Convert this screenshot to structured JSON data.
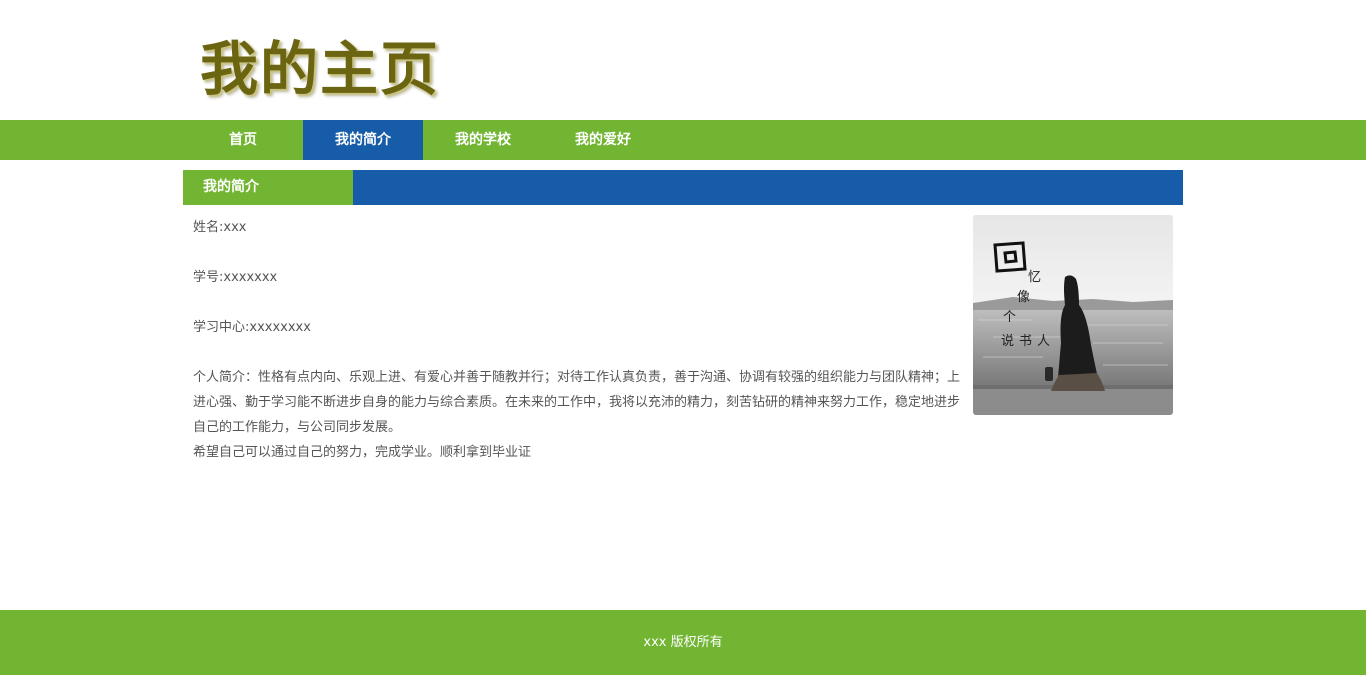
{
  "header": {
    "title": "我的主页"
  },
  "nav": {
    "items": [
      {
        "label": "首页"
      },
      {
        "label": "我的简介"
      },
      {
        "label": "我的学校"
      },
      {
        "label": "我的爱好"
      }
    ],
    "active_index": 1
  },
  "section": {
    "title": "我的简介"
  },
  "profile": {
    "name_line": "姓名:xxx",
    "student_id_line": "学号:xxxxxxx",
    "study_center_line": "学习中心:xxxxxxxx",
    "intro": "个人简介：性格有点内向、乐观上进、有爱心并善于随教并行；对待工作认真负责，善于沟通、协调有较强的组织能力与团队精神；上进心强、勤于学习能不断进步自身的能力与综合素质。在未来的工作中，我将以充沛的精力，刻苦钻研的精神来努力工作，稳定地进步自己的工作能力，与公司同步发展。",
    "hope": "希望自己可以通过自己的努力，完成学业。顺利拿到毕业证"
  },
  "photo": {
    "icon": "profile-photo",
    "caption_chars": [
      "回",
      "忆",
      "像",
      "个",
      "说",
      "书",
      "人"
    ]
  },
  "footer": {
    "text": "xxx  版权所有"
  },
  "colors": {
    "green": "#71b532",
    "blue": "#165ca8",
    "title": "#6b6410",
    "text": "#555555"
  }
}
